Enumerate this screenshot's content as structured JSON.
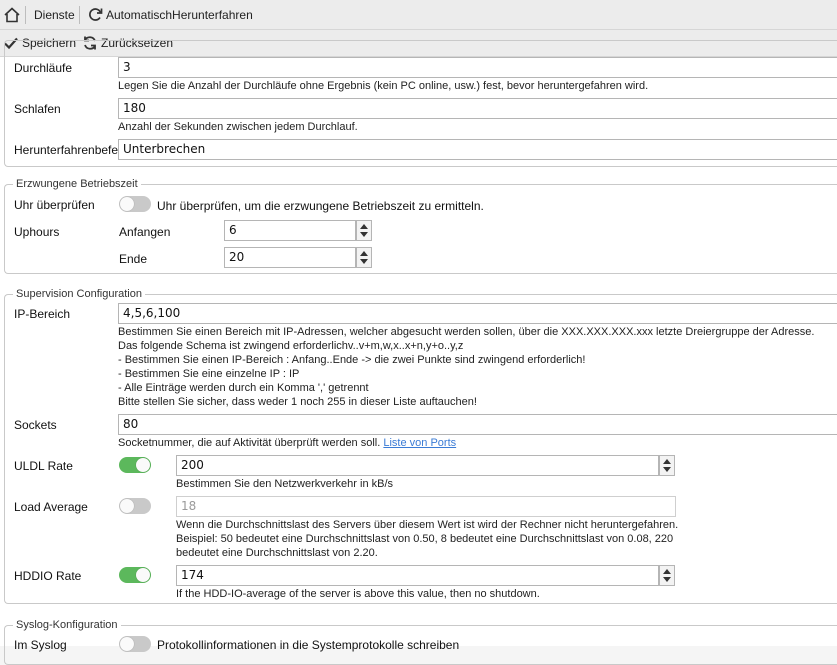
{
  "breadcrumb": {
    "home_icon": "home-icon",
    "item1": "Dienste",
    "refresh_icon": "refresh-icon",
    "item2": "AutomatischHerunterfahren"
  },
  "toolbar": {
    "save_label": "Speichern",
    "reset_label": "Zurücksetzen"
  },
  "general": {
    "durchlaeufe_label": "Durchläufe",
    "durchlaeufe_value": "3",
    "durchlaeufe_help": "Legen Sie die Anzahl der Durchläufe ohne Ergebnis (kein PC online, usw.) fest, bevor heruntergefahren wird.",
    "schlafen_label": "Schlafen",
    "schlafen_value": "180",
    "schlafen_help": "Anzahl der Sekunden zwischen jedem Durchlauf.",
    "befehl_label": "Herunterfahrenbefe",
    "befehl_value": "Unterbrechen"
  },
  "forced_uptime": {
    "legend": "Erzwungene Betriebszeit",
    "check_label": "Uhr überprüfen",
    "check_toggle_on": false,
    "check_desc": "Uhr überprüfen, um die erzwungene Betriebszeit zu ermitteln.",
    "uphours_label": "Uphours",
    "start_label": "Anfangen",
    "start_value": "6",
    "end_label": "Ende",
    "end_value": "20"
  },
  "supervision": {
    "legend": "Supervision Configuration",
    "ip_label": "IP-Bereich",
    "ip_value": "4,5,6,100",
    "ip_help": [
      "Bestimmen Sie einen Bereich mit IP-Adressen, welcher abgesucht werden sollen, über die XXX.XXX.XXX.xxx letzte Dreiergruppe der Adresse.",
      "Das folgende Schema ist zwingend erforderlichv..v+m,w,x..x+n,y+o..y,z",
      "- Bestimmen Sie einen IP-Bereich : Anfang..Ende -> die zwei Punkte sind zwingend erforderlich!",
      "- Bestimmen Sie eine einzelne IP : IP",
      "- Alle Einträge werden durch ein Komma ',' getrennt",
      "Bitte stellen Sie sicher, dass weder 1 noch 255 in dieser Liste auftauchen!"
    ],
    "sockets_label": "Sockets",
    "sockets_value": "80",
    "sockets_help": "Socketnummer, die auf Aktivität überprüft werden soll.",
    "sockets_link": "Liste von Ports",
    "uldl_label": "ULDL Rate",
    "uldl_on": true,
    "uldl_value": "200",
    "uldl_help": "Bestimmen Sie den Netzwerkverkehr in kB/s",
    "load_label": "Load Average",
    "load_on": false,
    "load_value": "18",
    "load_help": [
      "Wenn die Durchschnittslast des Servers über diesem Wert ist wird der Rechner nicht heruntergefahren.",
      "Beispiel: 50 bedeutet eine Durchschnittslast von 0.50, 8 bedeutet eine Durchschnittslast von 0.08, 220",
      "bedeutet eine Durchschnittslast von 2.20."
    ],
    "hddio_label": "HDDIO Rate",
    "hddio_on": true,
    "hddio_value": "174",
    "hddio_help": "If the HDD-IO-average of the server is above this value, then no shutdown."
  },
  "syslog": {
    "legend": "Syslog-Konfiguration",
    "label": "Im Syslog",
    "toggle_on": false,
    "desc": "Protokollinformationen in die Systemprotokolle schreiben"
  },
  "colors": {
    "toggle_on": "#5cb85c",
    "toggle_off": "#c9c9c9",
    "link": "#3a7bd5"
  }
}
